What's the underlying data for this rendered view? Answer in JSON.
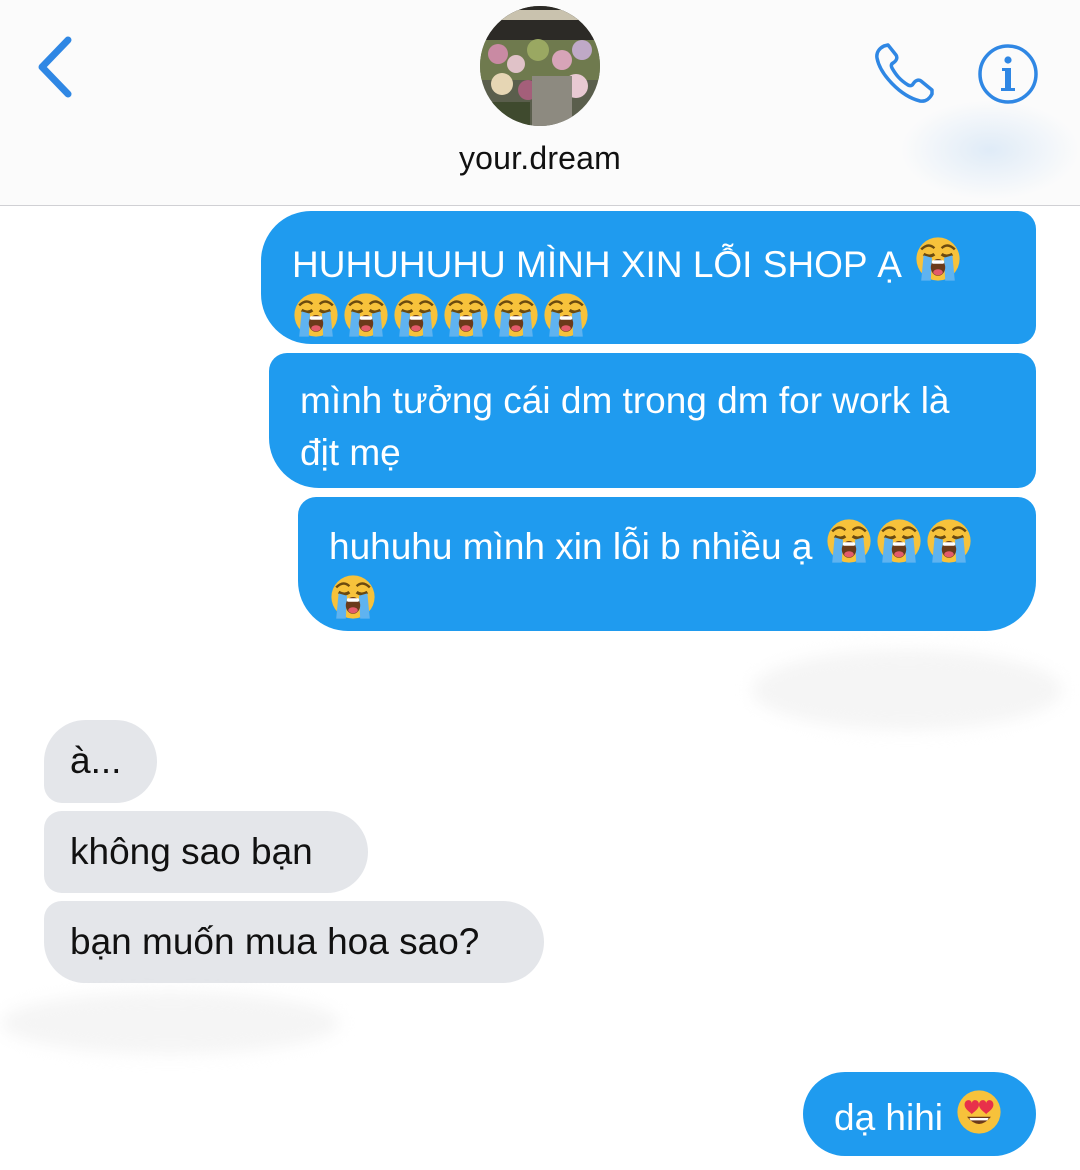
{
  "header": {
    "contact_name": "your.dream"
  },
  "messages": [
    {
      "direction": "outgoing",
      "text": "HUHUHUHU MÌNH XIN LỖI SHOP Ạ",
      "emoji": "loudly-crying-face",
      "emoji_count": 7
    },
    {
      "direction": "outgoing",
      "text_line1": "mình tưởng cái dm trong dm for work là",
      "text_line2": "địt mẹ"
    },
    {
      "direction": "outgoing",
      "text": "huhuhu mình xin lỗi b nhiều ạ",
      "emoji": "loudly-crying-face",
      "emoji_count": 4
    },
    {
      "direction": "incoming",
      "text": "à..."
    },
    {
      "direction": "incoming",
      "text": "không sao bạn"
    },
    {
      "direction": "incoming",
      "text": "bạn muốn mua hoa sao?"
    },
    {
      "direction": "outgoing",
      "text": "dạ hihi",
      "emoji": "smiling-face-with-heart-eyes",
      "emoji_count": 1
    }
  ],
  "colors": {
    "accent": "#1f9bef",
    "outgoing_bubble": "#1f9bef",
    "incoming_bubble": "#e4e6ea",
    "icon_blue": "#2f87e4"
  }
}
